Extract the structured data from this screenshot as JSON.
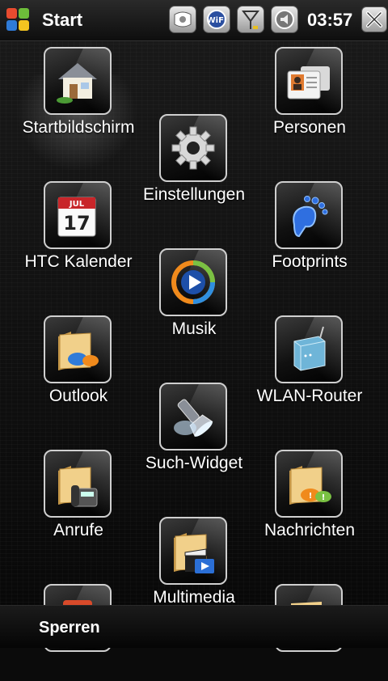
{
  "header": {
    "title": "Start",
    "clock": "03:57",
    "status_icons": [
      "sync-icon",
      "wifi-icon",
      "signal-icon",
      "volume-icon"
    ]
  },
  "apps": [
    {
      "label": "Startbildschirm",
      "icon": "home-icon"
    },
    {
      "label": "Personen",
      "icon": "contacts-icon"
    },
    {
      "label": "Einstellungen",
      "icon": "gear-icon"
    },
    {
      "label": "HTC Kalender",
      "icon": "calendar-icon",
      "day": "17",
      "month": "JUL"
    },
    {
      "label": "Footprints",
      "icon": "footprints-icon"
    },
    {
      "label": "Musik",
      "icon": "play-icon"
    },
    {
      "label": "Outlook",
      "icon": "folder-chat-icon"
    },
    {
      "label": "WLAN-Router",
      "icon": "router-icon"
    },
    {
      "label": "Such-Widget",
      "icon": "flashlight-icon"
    },
    {
      "label": "Anrufe",
      "icon": "folder-phone-icon"
    },
    {
      "label": "Nachrichten",
      "icon": "folder-messages-icon"
    },
    {
      "label": "Multimedia",
      "icon": "folder-media-icon"
    }
  ],
  "footer": {
    "softkey_left": "Sperren"
  },
  "colors": {
    "accent_blue": "#2b6fd6",
    "tile_border": "#cfcfcf"
  }
}
